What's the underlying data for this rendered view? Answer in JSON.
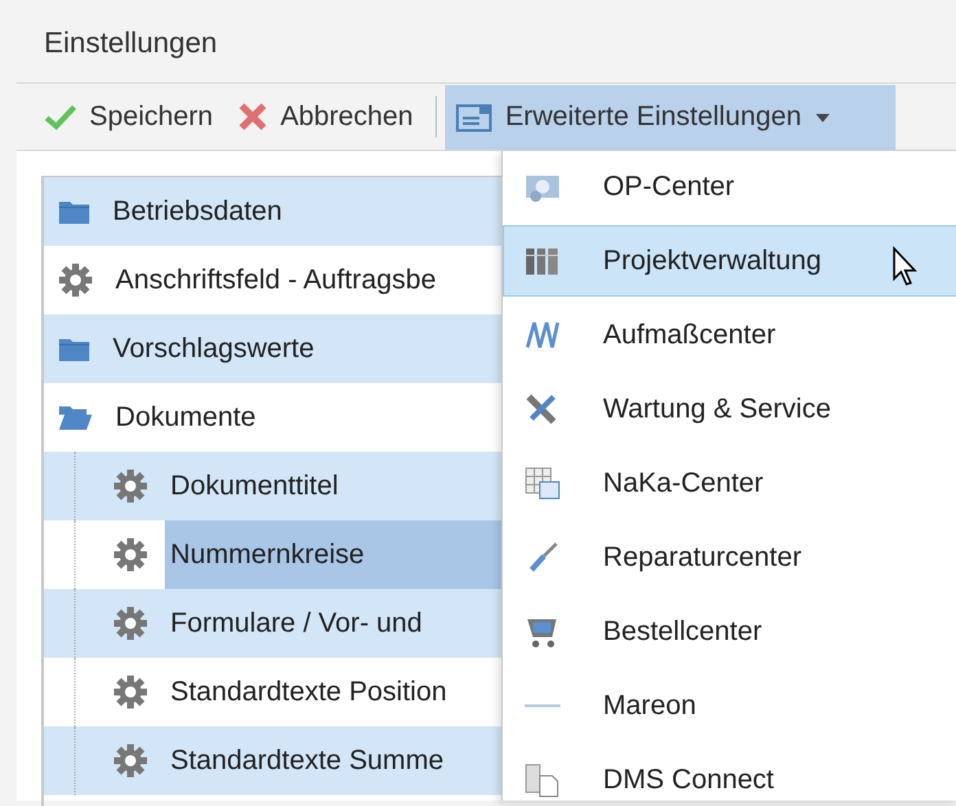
{
  "window": {
    "title": "Einstellungen"
  },
  "toolbar": {
    "buttons": [
      {
        "kind": "save",
        "label": "Speichern"
      },
      {
        "kind": "cancel",
        "label": "Abbrechen"
      }
    ],
    "dropdown": {
      "label": "Erweiterte Einstellungen",
      "expanded": true
    }
  },
  "tree": {
    "items": [
      {
        "kind": "folder",
        "label": "Betriebsdaten",
        "selected": false
      },
      {
        "kind": "setting",
        "label": "Anschriftsfeld - Auftragsbe",
        "selected": false
      },
      {
        "kind": "folder",
        "label": "Vorschlagswerte",
        "selected": false
      },
      {
        "kind": "folder",
        "label": "Dokumente",
        "selected": false,
        "expanded": true,
        "children": [
          {
            "kind": "setting",
            "label": "Dokumenttitel",
            "selected": false
          },
          {
            "kind": "setting",
            "label": "Nummernkreise",
            "selected": true
          },
          {
            "kind": "setting",
            "label": "Formulare / Vor- und",
            "selected": false
          },
          {
            "kind": "setting",
            "label": "Standardtexte Position",
            "selected": false
          },
          {
            "kind": "setting",
            "label": "Standardtexte Summe",
            "selected": false
          }
        ]
      }
    ]
  },
  "menu": {
    "items": [
      {
        "label": "OP-Center",
        "selected": false
      },
      {
        "label": "Projektverwaltung",
        "selected": true
      },
      {
        "label": "Aufmaßcenter",
        "selected": false
      },
      {
        "label": "Wartung & Service",
        "selected": false
      },
      {
        "label": "NaKa-Center",
        "selected": false
      },
      {
        "label": "Reparaturcenter",
        "selected": false
      },
      {
        "label": "Bestellcenter",
        "selected": false
      },
      {
        "label": "Mareon",
        "selected": false
      },
      {
        "label": "DMS Connect",
        "selected": false
      }
    ]
  }
}
